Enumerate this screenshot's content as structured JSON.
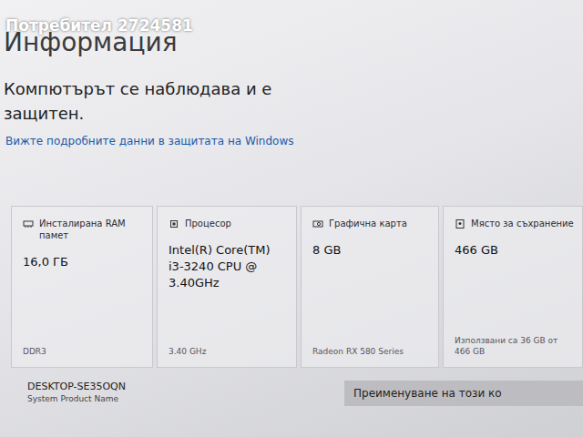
{
  "watermark": "Потребител 2724581",
  "page": {
    "title": "Информация",
    "status": "Компютърът се наблюдава и е защитен.",
    "link": "Вижте подробните данни в защитата на Windows"
  },
  "specs": [
    {
      "kind": "ram",
      "label": "Инсталирана RAM памет",
      "value": "16,0 ГБ",
      "detail": "DDR3"
    },
    {
      "kind": "cpu",
      "label": "Процесор",
      "value": "Intel(R) Core(TM) i3-3240 CPU @ 3.40GHz",
      "detail": "3.40 GHz"
    },
    {
      "kind": "gpu",
      "label": "Графична карта",
      "value": "8 GB",
      "detail": "Radeon RX 580 Series"
    },
    {
      "kind": "storage",
      "label": "Място за съхранение",
      "value": "466 GB",
      "detail": "Използвани са 36 GB от 466 GB"
    }
  ],
  "device": {
    "name": "DESKTOP-SE35OQN",
    "model": "System Product Name"
  },
  "buttons": [
    {
      "label": "Преименуване на този ко"
    }
  ]
}
